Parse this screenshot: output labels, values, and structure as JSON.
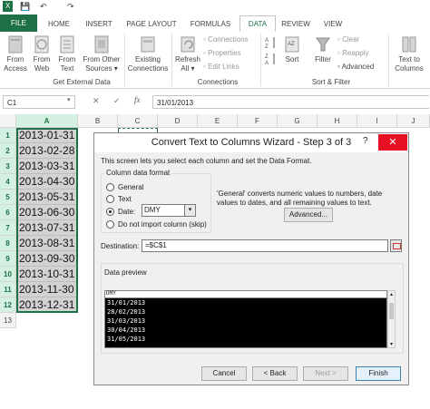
{
  "quick_access": {
    "save": "💾",
    "undo": "↶",
    "redo": "↷"
  },
  "tabs": [
    "FILE",
    "HOME",
    "INSERT",
    "PAGE LAYOUT",
    "FORMULAS",
    "DATA",
    "REVIEW",
    "VIEW"
  ],
  "ribbon": {
    "from_access": [
      "From",
      "Access"
    ],
    "from_web": [
      "From",
      "Web"
    ],
    "from_text": [
      "From",
      "Text"
    ],
    "from_other": [
      "From Other",
      "Sources ▾"
    ],
    "existing": [
      "Existing",
      "Connections"
    ],
    "refresh": [
      "Refresh",
      "All ▾"
    ],
    "connections": "Connections",
    "properties": "Properties",
    "edit_links": "Edit Links",
    "sort": "Sort",
    "filter": "Filter",
    "clear": "Clear",
    "reapply": "Reapply",
    "advanced": "Advanced",
    "text_to_columns": [
      "Text to",
      "Columns"
    ],
    "group_external": "Get External Data",
    "group_connections": "Connections",
    "group_sort": "Sort & Filter"
  },
  "formula_bar": {
    "name_box": "C1",
    "cancel": "✕",
    "enter": "✓",
    "fx": "fx",
    "value": "31/01/2013"
  },
  "columns": [
    "A",
    "B",
    "C",
    "D",
    "E",
    "F",
    "G",
    "H",
    "I",
    "J"
  ],
  "rows": [
    "1",
    "2",
    "3",
    "4",
    "5",
    "6",
    "7",
    "8",
    "9",
    "10",
    "11",
    "12",
    "13"
  ],
  "cells_a": [
    "2013-01-31",
    "2013-02-28",
    "2013-03-31",
    "2013-04-30",
    "2013-05-31",
    "2013-06-30",
    "2013-07-31",
    "2013-08-31",
    "2013-09-30",
    "2013-10-31",
    "2013-11-30",
    "2013-12-31"
  ],
  "dialog": {
    "title": "Convert Text to Columns Wizard - Step 3 of 3",
    "help": "?",
    "close": "✕",
    "intro": "This screen lets you select each column and set the Data Format.",
    "column_format_label": "Column data format",
    "opt_general": "General",
    "opt_text": "Text",
    "opt_date": "Date:",
    "date_value": "DMY",
    "opt_skip": "Do not import column (skip)",
    "general_info": "'General' converts numeric values to numbers, date values to dates, and all remaining values to text.",
    "advanced_btn": "Advanced...",
    "destination_label": "Destination:",
    "destination_value": "=$C$1",
    "preview_label": "Data preview",
    "preview_header": "DMY",
    "preview_rows": [
      "31/01/2013",
      "28/02/2013",
      "31/03/2013",
      "30/04/2013",
      "31/05/2013"
    ],
    "cancel_btn": "Cancel",
    "back_btn": "< Back",
    "next_btn": "Next >",
    "finish_btn": "Finish"
  }
}
